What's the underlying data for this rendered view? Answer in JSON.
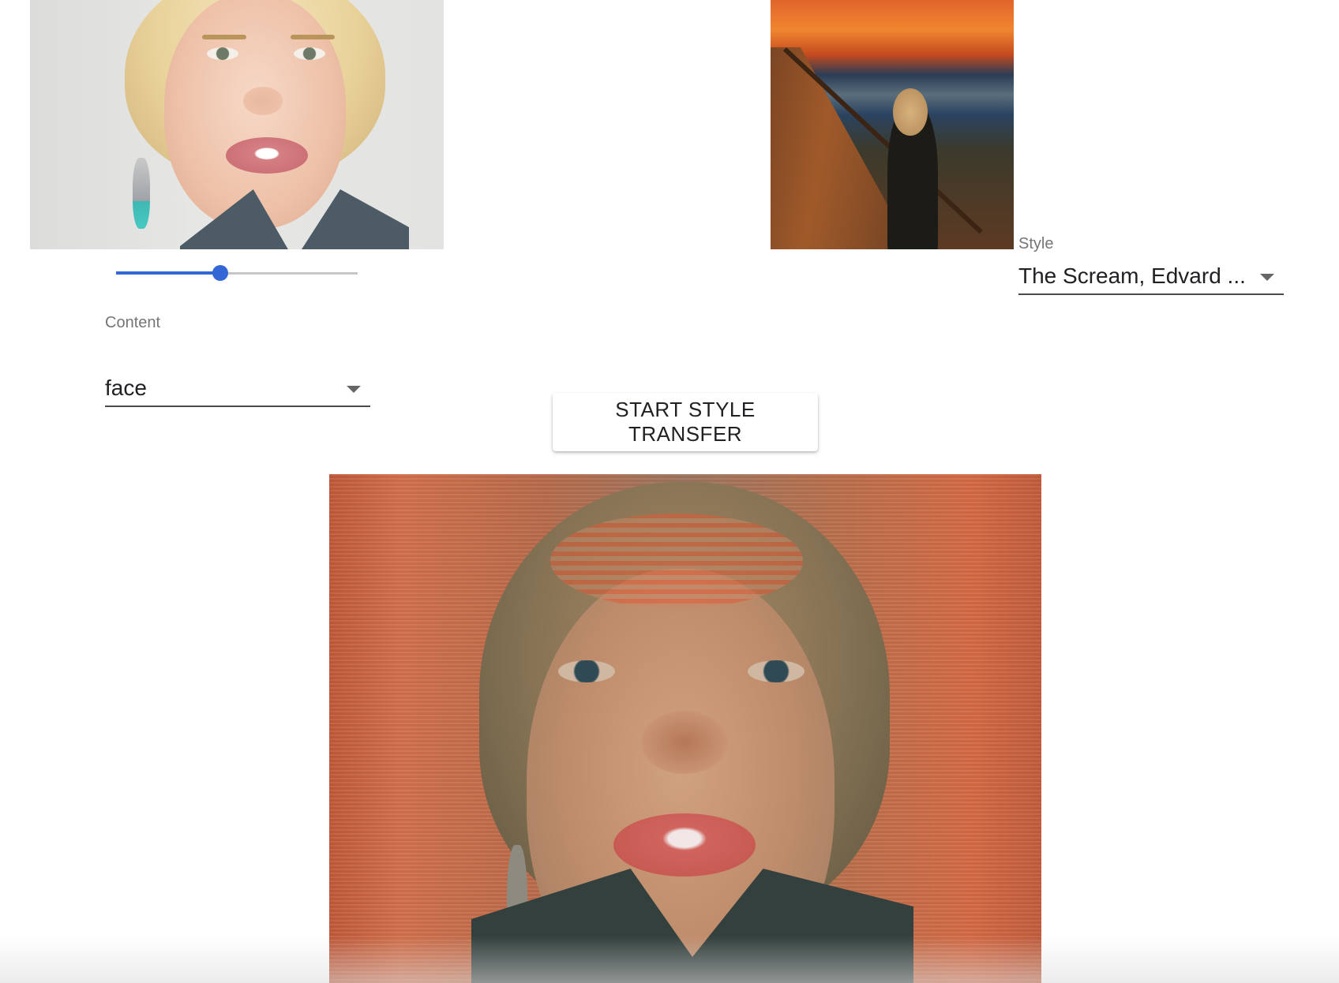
{
  "content": {
    "image_alt": "content photo",
    "label": "Content",
    "selected": "face"
  },
  "style": {
    "image_alt": "style painting",
    "label": "Style",
    "selected": "The Scream, Edvard ..."
  },
  "size_slider": {
    "value_fraction": 0.43
  },
  "actions": {
    "start_label": "START STYLE TRANSFER"
  },
  "result": {
    "image_alt": "stylized result"
  },
  "colors": {
    "accent": "#3367d6",
    "underline": "#4a4a4a",
    "label": "#757575"
  }
}
